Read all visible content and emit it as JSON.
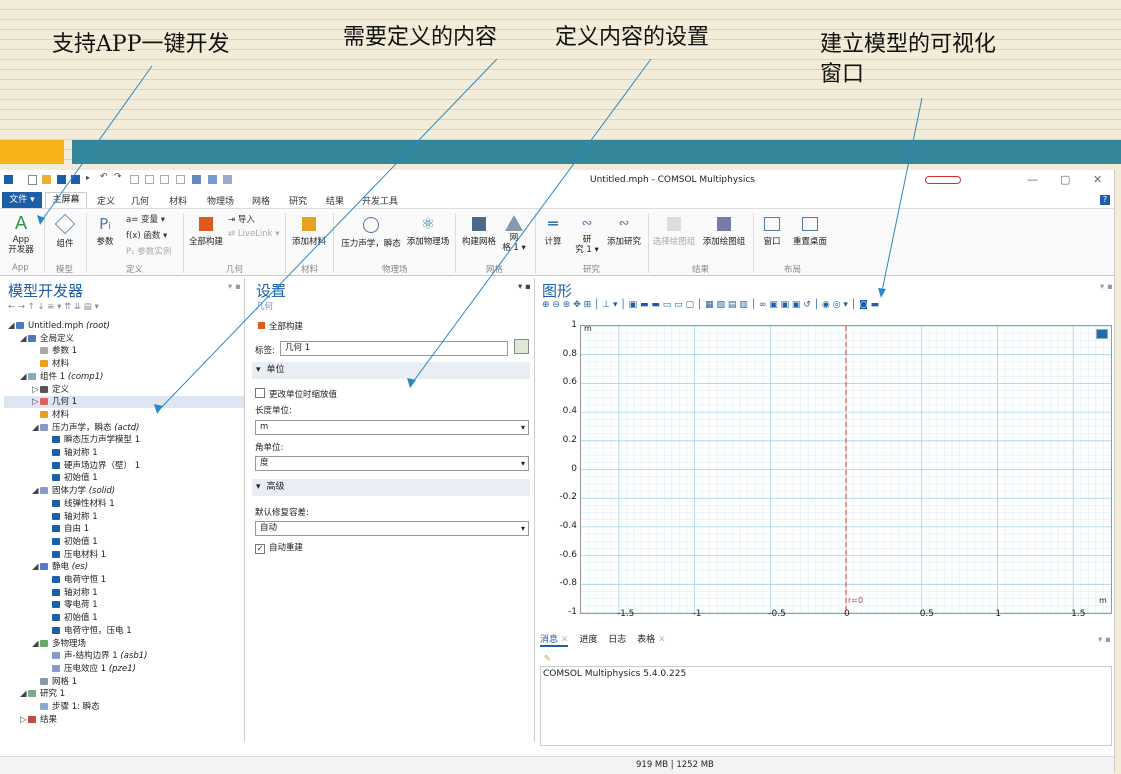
{
  "annotations": [
    {
      "text": "支持APP一键开发"
    },
    {
      "text": "需要定义的内容"
    },
    {
      "text": "定义内容的设置"
    },
    {
      "text": "建立模型的可视化",
      "text2": "窗口"
    }
  ],
  "window": {
    "title": "Untitled.mph - COMSOL Multiphysics",
    "minimize": "—",
    "maximize": "▢",
    "close": "✕"
  },
  "menu_tabs": [
    "文件 ▾",
    "主屏幕",
    "定义",
    "几何",
    "材料",
    "物理场",
    "网格",
    "研究",
    "结果",
    "开发工具"
  ],
  "help_label": "?",
  "ribbon": {
    "app_label": "App\n开发器",
    "component": "组件",
    "params": "参数",
    "variables": "a= 变量 ▾",
    "functions": "f(x) 函数 ▾",
    "param_case": "P₁ 参数实例",
    "build_all": "全部构建",
    "import": "⇥ 导入",
    "livelink": "⇄ LiveLink ▾",
    "add_material": "添加材料",
    "pressure_acoustics": "压力声学，瞬态",
    "add_physics": "添加物理场",
    "build_mesh": "构建网格",
    "mesh1": "网\n格 1 ▾",
    "compute": "计算",
    "study1": "研\n究 1 ▾",
    "add_study": "添加研究",
    "select_plot_group": "选择绘图组",
    "add_plot_group": "添加绘图组",
    "windows": "窗口",
    "reset_desktop": "重置桌面",
    "groups": [
      "App",
      "模型",
      "定义",
      "几何",
      "材料",
      "物理场",
      "网格",
      "研究",
      "结果",
      "布局"
    ]
  },
  "model_builder": {
    "title": "模型开发器",
    "tree": [
      {
        "label": "Untitled.mph",
        "em": "(root)",
        "indent": 0,
        "arrow": "◢",
        "color": "#4a7ab8"
      },
      {
        "label": "全局定义",
        "em": "",
        "indent": 1,
        "arrow": "◢",
        "color": "#4a7ab8"
      },
      {
        "label": "参数 1",
        "em": "",
        "indent": 2,
        "arrow": "",
        "color": "#aaaaaa"
      },
      {
        "label": "材料",
        "em": "",
        "indent": 2,
        "arrow": "",
        "color": "#e8a020"
      },
      {
        "label": "组件 1",
        "em": "(comp1)",
        "indent": 1,
        "arrow": "◢",
        "color": "#8ab"
      },
      {
        "label": "定义",
        "em": "",
        "indent": 2,
        "arrow": "▷",
        "color": "#555555"
      },
      {
        "label": "几何 1",
        "em": "",
        "indent": 2,
        "arrow": "▷",
        "color": "#e06060",
        "sel": true
      },
      {
        "label": "材料",
        "em": "",
        "indent": 2,
        "arrow": "",
        "color": "#e8a020"
      },
      {
        "label": "压力声学，瞬态",
        "em": "(actd)",
        "indent": 2,
        "arrow": "◢",
        "color": "#8899cc"
      },
      {
        "label": "瞬态压力声学模型 1",
        "em": "",
        "indent": 3,
        "arrow": "",
        "color": "#1d5ea8"
      },
      {
        "label": "轴对称 1",
        "em": "",
        "indent": 3,
        "arrow": "",
        "color": "#1d5ea8"
      },
      {
        "label": "硬声场边界（壁） 1",
        "em": "",
        "indent": 3,
        "arrow": "",
        "color": "#1d5ea8"
      },
      {
        "label": "初始值 1",
        "em": "",
        "indent": 3,
        "arrow": "",
        "color": "#1d5ea8"
      },
      {
        "label": "固体力学",
        "em": "(solid)",
        "indent": 2,
        "arrow": "◢",
        "color": "#8899cc"
      },
      {
        "label": "线弹性材料 1",
        "em": "",
        "indent": 3,
        "arrow": "",
        "color": "#1d5ea8"
      },
      {
        "label": "轴对称 1",
        "em": "",
        "indent": 3,
        "arrow": "",
        "color": "#1d5ea8"
      },
      {
        "label": "自由 1",
        "em": "",
        "indent": 3,
        "arrow": "",
        "color": "#1d5ea8"
      },
      {
        "label": "初始值 1",
        "em": "",
        "indent": 3,
        "arrow": "",
        "color": "#1d5ea8"
      },
      {
        "label": "压电材料 1",
        "em": "",
        "indent": 3,
        "arrow": "",
        "color": "#1d5ea8"
      },
      {
        "label": "静电",
        "em": "(es)",
        "indent": 2,
        "arrow": "◢",
        "color": "#5577cc"
      },
      {
        "label": "电荷守恒 1",
        "em": "",
        "indent": 3,
        "arrow": "",
        "color": "#1d5ea8"
      },
      {
        "label": "轴对称 1",
        "em": "",
        "indent": 3,
        "arrow": "",
        "color": "#1d5ea8"
      },
      {
        "label": "零电荷 1",
        "em": "",
        "indent": 3,
        "arrow": "",
        "color": "#1d5ea8"
      },
      {
        "label": "初始值 1",
        "em": "",
        "indent": 3,
        "arrow": "",
        "color": "#1d5ea8"
      },
      {
        "label": "电荷守恒，压电 1",
        "em": "",
        "indent": 3,
        "arrow": "",
        "color": "#1d5ea8"
      },
      {
        "label": "多物理场",
        "em": "",
        "indent": 2,
        "arrow": "◢",
        "color": "#66aa66"
      },
      {
        "label": "声-结构边界 1",
        "em": "(asb1)",
        "indent": 3,
        "arrow": "",
        "color": "#8899cc"
      },
      {
        "label": "压电效应 1",
        "em": "(pze1)",
        "indent": 3,
        "arrow": "",
        "color": "#8899cc"
      },
      {
        "label": "网格 1",
        "em": "",
        "indent": 2,
        "arrow": "",
        "color": "#8899aa"
      },
      {
        "label": "研究 1",
        "em": "",
        "indent": 1,
        "arrow": "◢",
        "color": "#7aaa88"
      },
      {
        "label": "步骤 1: 瞬态",
        "em": "",
        "indent": 2,
        "arrow": "",
        "color": "#88aacc"
      },
      {
        "label": "结果",
        "em": "",
        "indent": 1,
        "arrow": "▷",
        "color": "#cc4444"
      }
    ]
  },
  "settings": {
    "title": "设置",
    "subtitle": "几何",
    "build_all": "全部构建",
    "label_caption": "标签:",
    "label_value": "几何 1",
    "section_units": "单位",
    "scale_values": "更改单位时缩放值",
    "length_unit_caption": "长度单位:",
    "length_unit": "m",
    "angle_unit_caption": "角单位:",
    "angle_unit": "度",
    "section_advanced": "高级",
    "repair_caption": "默认修复容差:",
    "repair_value": "自动",
    "auto_rebuild": "自动重建"
  },
  "graphics": {
    "title": "图形",
    "unit_y": "m",
    "unit_x": "m",
    "r0": "r=0"
  },
  "chart_data": {
    "type": "line",
    "xticks": [
      "-1.5",
      "-1",
      "-0.5",
      "0",
      "0.5",
      "1",
      "1.5"
    ],
    "yticks": [
      "1",
      "0.8",
      "0.6",
      "0.4",
      "0.2",
      "0",
      "-0.2",
      "-0.4",
      "-0.6",
      "-0.8",
      "-1"
    ],
    "xlim": [
      -1.75,
      1.75
    ],
    "ylim": [
      -1,
      1
    ],
    "grid": true
  },
  "bottom_tabs": [
    "消息",
    "进度",
    "日志",
    "表格"
  ],
  "message": "COMSOL Multiphysics 5.4.0.225",
  "status": "919 MB | 1252 MB"
}
